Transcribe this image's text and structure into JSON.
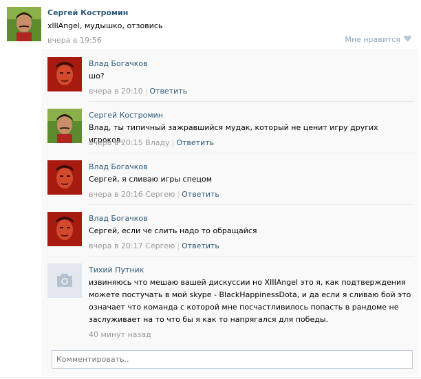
{
  "post": {
    "author": "Сергей Костромин",
    "text": "xlllAngel, мудышко, отзовись",
    "time": "вчера в 19:56",
    "like_label": "Мне нравится"
  },
  "replies": [
    {
      "author": "Влад Богачков",
      "text": "шо?",
      "time": "вчера в 20:10",
      "to": "",
      "reply_label": "Ответить"
    },
    {
      "author": "Сергей Костромин",
      "text": "Влад, ты типичный зажравшийся мудак, который не ценит игру других игроков.",
      "time": "вчера в 20:15",
      "to": "Владу",
      "reply_label": "Ответить"
    },
    {
      "author": "Влад Богачков",
      "text": "Сергей, я сливаю игры спецом",
      "time": "вчера в 20:16",
      "to": "Сергею",
      "reply_label": "Ответить"
    },
    {
      "author": "Влад Богачков",
      "text": "Сергей, если че слить надо то обращайся",
      "time": "вчера в 20:17",
      "to": "Сергею",
      "reply_label": "Ответить"
    },
    {
      "author": "Тихий Путник",
      "text": "извиняюсь что мешаю вашей дискуссии но XIIIAngel это я, как подтверждения можете постучать в мой skype - BlackHappinessDota, и да если я сливаю бой это означает что команда с которой мне посчастливилось попасть в рандоме не заслуживает на то что бы я как то напрягался для победы.",
      "time": "40 минут назад"
    }
  ],
  "comment_input": {
    "placeholder": "Комментировать.."
  },
  "colors": {
    "link": "#2b587a",
    "meta": "#999999",
    "background_replies": "#f9f9f9"
  },
  "icons": {
    "like": "heart-icon",
    "no_avatar": "camera-icon"
  }
}
